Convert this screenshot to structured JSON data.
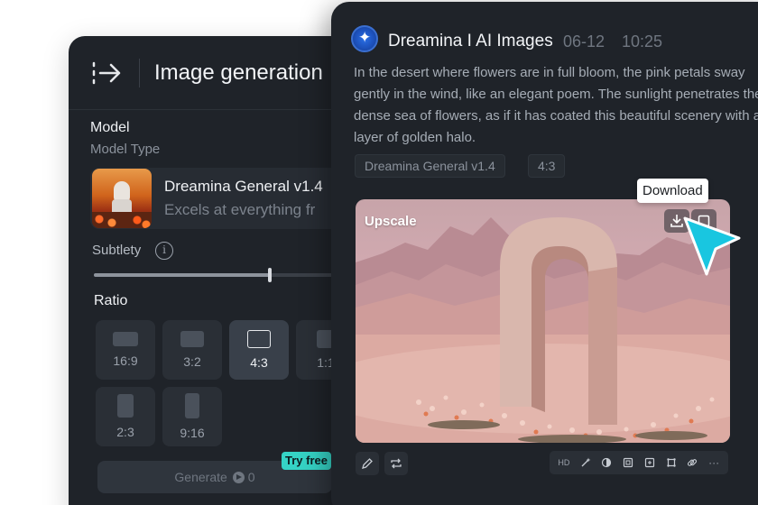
{
  "image_generation_panel": {
    "title": "Image generation",
    "model_section_label": "Model",
    "model_type_label": "Model Type",
    "model": {
      "name": "Dreamina General v1.4",
      "description": "Excels at everything fr"
    },
    "subtlety": {
      "label": "Subtlety",
      "value_fraction": 0.65
    },
    "ratio_label": "Ratio",
    "ratios": [
      {
        "label": "16:9",
        "selected": false
      },
      {
        "label": "3:2",
        "selected": false
      },
      {
        "label": "4:3",
        "selected": true
      },
      {
        "label": "1:1",
        "selected": false
      },
      {
        "label": "2:3",
        "selected": false
      },
      {
        "label": "9:16",
        "selected": false
      }
    ],
    "generate_label": "Generate",
    "generate_cost": "0",
    "try_free_label": "Try free"
  },
  "message_panel": {
    "app_name": "Dreamina I AI Images",
    "date": "06-12",
    "time": "10:25",
    "prompt": "In the desert where flowers are in full bloom, the pink petals sway gently in the wind, like an elegant poem. The sunlight penetrates the dense sea of flowers, as if it has coated this beautiful scenery with a layer of golden halo.",
    "tags": [
      "Dreamina General v1.4",
      "4:3"
    ],
    "image": {
      "overlay_label": "Upscale",
      "download_tooltip": "Download"
    },
    "toolbar": {
      "hd_label": "HD",
      "more_label": "···"
    }
  },
  "colors": {
    "panel_bg": "#1f2329",
    "accent_teal": "#35d3c5",
    "cursor_cyan": "#19c6e0",
    "logo_blue": "#2a6fe6"
  },
  "icons": [
    "collapse-sidebar-icon",
    "info-icon",
    "coin-icon",
    "dreamina-logo-icon",
    "download-icon",
    "expand-icon",
    "edit-icon",
    "regenerate-icon",
    "magic-wand-icon",
    "eraser-icon",
    "frame-icon",
    "add-frame-icon",
    "crop-icon",
    "link-icon",
    "more-icon",
    "cursor-icon"
  ]
}
